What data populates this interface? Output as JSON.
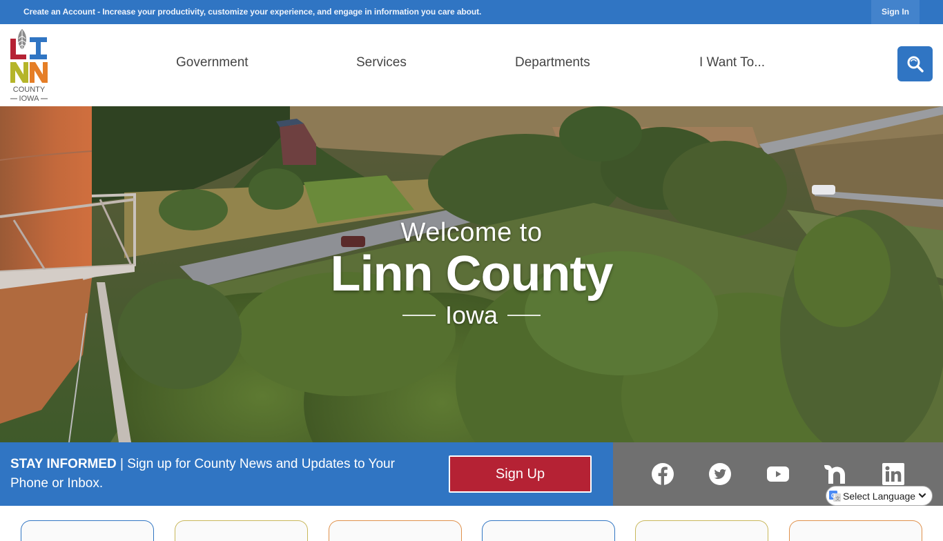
{
  "topbar": {
    "promo_text": "Create an Account - Increase your productivity, customize your experience, and engage in information you care about.",
    "sign_in_label": "Sign In"
  },
  "header": {
    "logo": {
      "letters": [
        "L",
        "I",
        "N",
        "N"
      ],
      "line1": "COUNTY",
      "line2": "IOWA",
      "colors": {
        "l": "#b52234",
        "i": "#3075c3",
        "n1": "#b5b52a",
        "n2": "#e57e27",
        "leaf": "#8a8a8a",
        "text": "#555555"
      }
    },
    "nav": [
      {
        "label": "Government"
      },
      {
        "label": "Services"
      },
      {
        "label": "Departments"
      },
      {
        "label": "I Want To..."
      }
    ],
    "search_icon": "search-icon"
  },
  "hero": {
    "welcome": "Welcome to",
    "title": "Linn County",
    "subtitle": "Iowa"
  },
  "stay_informed": {
    "heading": "STAY INFORMED",
    "separator": " | ",
    "text": "Sign up for County News and Updates to Your Phone or Inbox.",
    "button_label": "Sign Up"
  },
  "social": [
    {
      "name": "facebook",
      "icon": "facebook-icon"
    },
    {
      "name": "twitter",
      "icon": "twitter-icon"
    },
    {
      "name": "youtube",
      "icon": "youtube-icon"
    },
    {
      "name": "nextdoor",
      "icon": "nextdoor-icon"
    },
    {
      "name": "linkedin",
      "icon": "linkedin-icon"
    }
  ],
  "language": {
    "selected": "Select Language"
  },
  "cards": [
    {
      "color": "#3075c3"
    },
    {
      "color": "#c8b75a"
    },
    {
      "color": "#e0904a"
    },
    {
      "color": "#3075c3"
    },
    {
      "color": "#c8b75a"
    },
    {
      "color": "#e0904a"
    }
  ],
  "colors": {
    "brand_blue": "#3075c3",
    "signup_red": "#b52234",
    "social_gray": "#707070"
  }
}
